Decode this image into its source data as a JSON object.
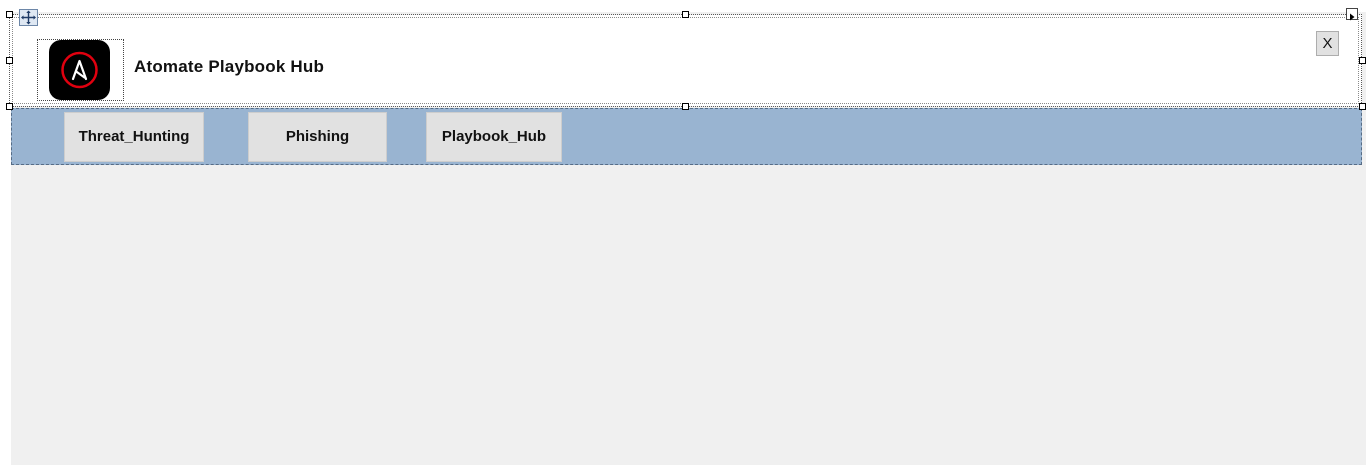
{
  "header": {
    "title": "Atomate Playbook Hub",
    "close_label": "X",
    "logo_icon": "ansible-logo-icon",
    "logo_letter": "A"
  },
  "nav": {
    "buttons": [
      {
        "label": "Threat_Hunting"
      },
      {
        "label": "Phishing"
      },
      {
        "label": "Playbook_Hub"
      }
    ]
  },
  "colors": {
    "nav_background": "#99b4d1",
    "header_background": "#ffffff",
    "body_background": "#f0f0f0",
    "button_background": "#e1e1e1",
    "logo_ring": "#e0000f"
  },
  "designer": {
    "move_icon": "move-arrows-icon",
    "smart_tag_icon": "smart-tag-arrow-icon"
  }
}
